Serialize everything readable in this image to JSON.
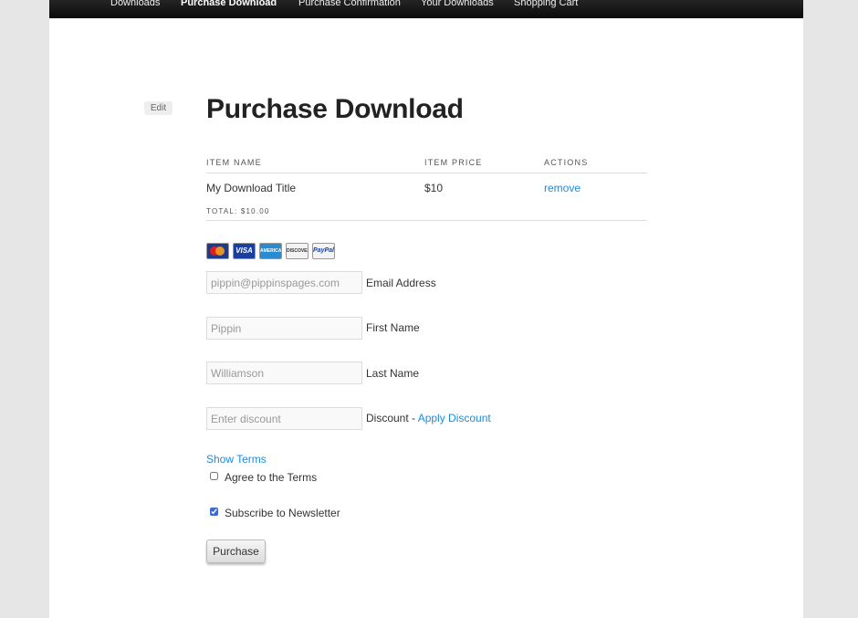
{
  "nav": {
    "items": [
      {
        "label": "Downloads",
        "active": false
      },
      {
        "label": "Purchase Download",
        "active": true
      },
      {
        "label": "Purchase Confirmation",
        "active": false
      },
      {
        "label": "Your Downloads",
        "active": false
      },
      {
        "label": "Shopping Cart",
        "active": false
      }
    ]
  },
  "edit_label": "Edit",
  "page_title": "Purchase Download",
  "cart": {
    "headers": {
      "name": "ITEM NAME",
      "price": "ITEM PRICE",
      "actions": "ACTIONS"
    },
    "items": [
      {
        "name": "My Download Title",
        "price": "$10",
        "action": "remove"
      }
    ],
    "total": "TOTAL: $10.00"
  },
  "payment_icons": [
    {
      "icon": "mastercard-icon",
      "label": ""
    },
    {
      "icon": "visa-icon",
      "label": "VISA"
    },
    {
      "icon": "amex-icon",
      "label": "AMERICAN EXPRESS"
    },
    {
      "icon": "discover-icon",
      "label": "DISCOVER"
    },
    {
      "icon": "paypal-icon",
      "label": "PayPal"
    }
  ],
  "form": {
    "email": {
      "placeholder": "pippin@pippinspages.com",
      "label": "Email Address"
    },
    "first_name": {
      "placeholder": "Pippin",
      "label": "First Name"
    },
    "last_name": {
      "placeholder": "Williamson",
      "label": "Last Name"
    },
    "discount": {
      "placeholder": "Enter discount",
      "label": "Discount -",
      "apply_link": "Apply Discount"
    },
    "show_terms": "Show Terms",
    "agree_terms": {
      "label": "Agree to the Terms",
      "checked": false
    },
    "newsletter": {
      "label": "Subscribe to Newsletter",
      "checked": true
    },
    "submit_label": "Purchase"
  },
  "colors": {
    "link": "#1b8be0",
    "nav_bg": "#111111",
    "page_bg": "#e6e6e6"
  }
}
